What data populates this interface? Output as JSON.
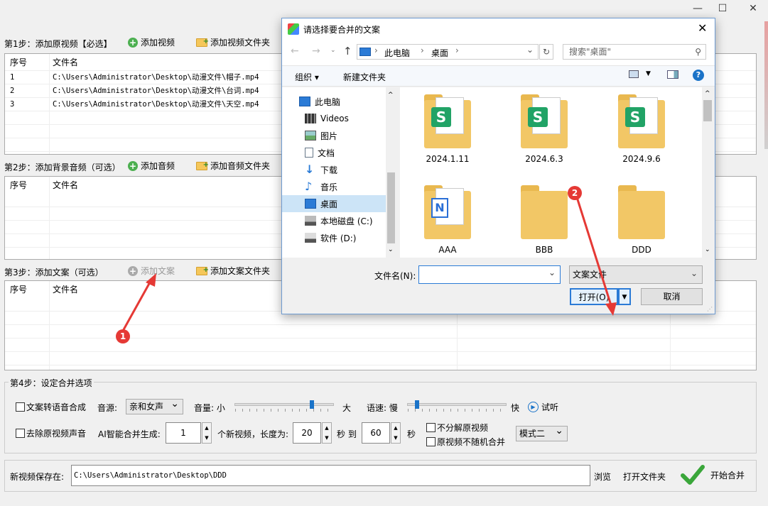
{
  "window": {
    "minimize": "—",
    "maximize": "☐",
    "close": "✕"
  },
  "step1": {
    "label": "第1步：添加原视频【必选】",
    "add_video": "添加视频",
    "add_video_folder": "添加视频文件夹",
    "col_index": "序号",
    "col_filename": "文件名",
    "rows": [
      {
        "index": "1",
        "file": "C:\\Users\\Administrator\\Desktop\\动漫文件\\帽子.mp4"
      },
      {
        "index": "2",
        "file": "C:\\Users\\Administrator\\Desktop\\动漫文件\\台词.mp4"
      },
      {
        "index": "3",
        "file": "C:\\Users\\Administrator\\Desktop\\动漫文件\\天空.mp4"
      }
    ]
  },
  "step2": {
    "label": "第2步：添加背景音频（可选）",
    "add_audio": "添加音频",
    "add_audio_folder": "添加音频文件夹",
    "col_index": "序号",
    "col_filename": "文件名"
  },
  "step3": {
    "label": "第3步：添加文案（可选）",
    "add_text": "添加文案",
    "add_text_folder": "添加文案文件夹",
    "col_index": "序号",
    "col_filename": "文件名"
  },
  "step4": {
    "label": "第4步：设定合并选项",
    "tts_label": "文案转语音合成",
    "voice_label": "音源:",
    "voice_value": "亲和女声",
    "volume_label": "音量: 小",
    "volume_max": "大",
    "volume_level": 0.78,
    "speed_label": "语速: 慢",
    "speed_max": "快",
    "speed_level": 0.1,
    "preview": "试听",
    "remove_audio": "去除原视频声音",
    "ai_label": "AI智能合并生成:",
    "count_value": "1",
    "count_suffix": "个新视频，长度为:",
    "min_len": "20",
    "to_label": "秒 到",
    "max_len": "60",
    "sec_label": "秒",
    "no_split": "不分解原视频",
    "no_random": "原视频不随机合并",
    "mode_value": "模式二"
  },
  "save": {
    "label": "新视频保存在:",
    "path": "C:\\Users\\Administrator\\Desktop\\DDD",
    "browse": "浏览",
    "open_folder": "打开文件夹",
    "start": "开始合并"
  },
  "dialog": {
    "title": "请选择要合并的文案",
    "breadcrumb_root": "此电脑",
    "breadcrumb_current": "桌面",
    "search_placeholder": "搜索\"桌面\"",
    "organize": "组织",
    "new_folder": "新建文件夹",
    "tree": [
      {
        "label": "此电脑",
        "icon": "computer-icon"
      },
      {
        "label": "Videos",
        "icon": "video-icon"
      },
      {
        "label": "图片",
        "icon": "pictures-icon"
      },
      {
        "label": "文档",
        "icon": "document-icon"
      },
      {
        "label": "下载",
        "icon": "download-icon"
      },
      {
        "label": "音乐",
        "icon": "music-icon"
      },
      {
        "label": "桌面",
        "icon": "desktop-icon"
      },
      {
        "label": "本地磁盘 (C:)",
        "icon": "drive-icon"
      },
      {
        "label": "软件 (D:)",
        "icon": "drive-icon"
      }
    ],
    "files": [
      {
        "name": "2024.1.11",
        "kind": "excel"
      },
      {
        "name": "2024.6.3",
        "kind": "excel"
      },
      {
        "name": "2024.9.6",
        "kind": "excel"
      },
      {
        "name": "AAA",
        "kind": "word"
      },
      {
        "name": "BBB",
        "kind": "plain"
      },
      {
        "name": "DDD",
        "kind": "plain"
      }
    ],
    "filename_label": "文件名(N):",
    "filename_value": "",
    "filetype_value": "文案文件",
    "open": "打开(O)",
    "cancel": "取消"
  },
  "markers": {
    "m1": "1",
    "m2": "2"
  },
  "colors": {
    "accent": "#1a73c8",
    "marker": "#e53935",
    "start_check": "#3aa63a"
  }
}
